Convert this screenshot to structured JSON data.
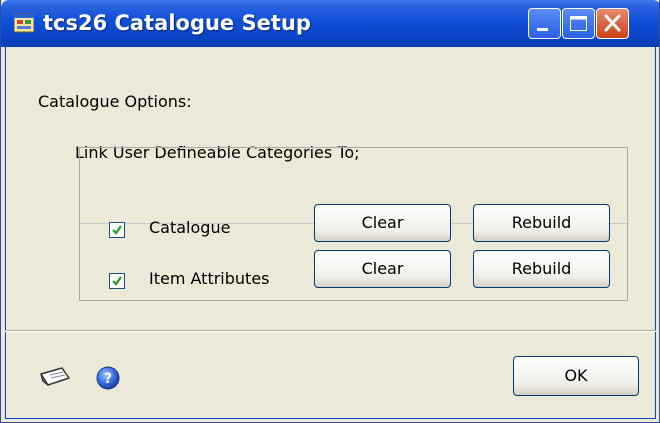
{
  "window": {
    "title": "tcs26 Catalogue Setup",
    "icons": [
      "app-icon",
      "minimize-icon",
      "maximize-icon",
      "close-icon"
    ]
  },
  "content": {
    "section_label": "Catalogue Options:",
    "link_label": "Link User Defineable Categories To;",
    "rows": [
      {
        "label": "Catalogue",
        "checked": true,
        "clear_label": "Clear",
        "rebuild_label": "Rebuild"
      },
      {
        "label": "Item Attributes",
        "checked": true,
        "clear_label": "Clear",
        "rebuild_label": "Rebuild"
      }
    ]
  },
  "footer": {
    "ok_label": "OK",
    "icons": [
      "note-icon",
      "help-icon"
    ]
  },
  "colors": {
    "titlebar": "#0a43c6",
    "dialog_bg": "#ece9d8",
    "checkmark": "#21a121",
    "close_button": "#c94319"
  }
}
